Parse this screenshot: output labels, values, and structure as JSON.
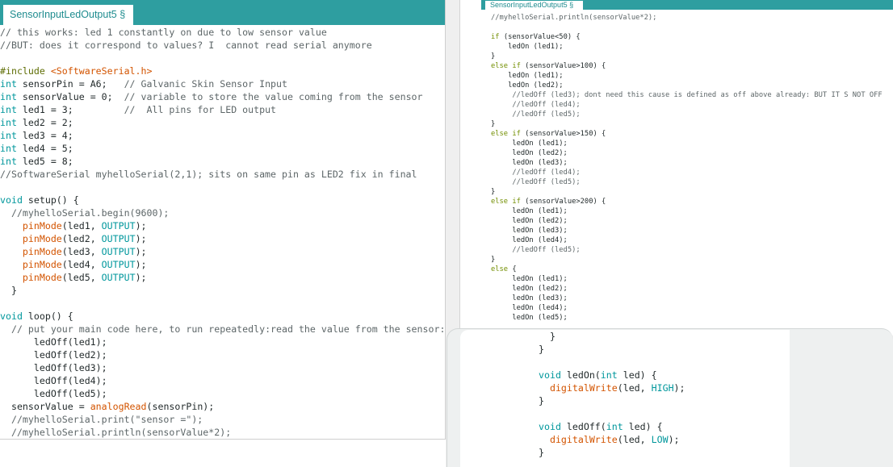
{
  "accent_color": "#2e9ea0",
  "tab_text_color": "#1f8c8f",
  "syntax_colors": {
    "tx": "#232b2c",
    "kw": "#00979c",
    "fn": "#d35400",
    "cm": "#5d6668",
    "pp": "#5e6d03",
    "ctl": "#728e00"
  },
  "left_editor": {
    "tab_label": "SensorInputLedOutput5 §",
    "lines": [
      [
        {
          "cm": "// this works: led 1 constantly on due to low sensor value"
        }
      ],
      [
        {
          "cm": "//BUT: does it correspond to values? I  cannot read serial anymore"
        }
      ],
      [],
      [
        {
          "pp": "#include "
        },
        {
          "fn": "<SoftwareSerial.h>"
        }
      ],
      [
        {
          "kw": "int"
        },
        {
          "tx": " sensorPin = A6;   "
        },
        {
          "cm": "// Galvanic Skin Sensor Input"
        }
      ],
      [
        {
          "kw": "int"
        },
        {
          "tx": " sensorValue = 0;  "
        },
        {
          "cm": "// variable to store the value coming from the sensor"
        }
      ],
      [
        {
          "kw": "int"
        },
        {
          "tx": " led1 = 3;         "
        },
        {
          "cm": "//  All pins for LED output"
        }
      ],
      [
        {
          "kw": "int"
        },
        {
          "tx": " led2 = 2;"
        }
      ],
      [
        {
          "kw": "int"
        },
        {
          "tx": " led3 = 4;"
        }
      ],
      [
        {
          "kw": "int"
        },
        {
          "tx": " led4 = 5;"
        }
      ],
      [
        {
          "kw": "int"
        },
        {
          "tx": " led5 = 8;"
        }
      ],
      [
        {
          "cm": "//SoftwareSerial myhelloSerial(2,1); sits on same pin as LED2 fix in final"
        }
      ],
      [],
      [
        {
          "kw": "void"
        },
        {
          "tx": " setup() {"
        }
      ],
      [
        {
          "tx": "  "
        },
        {
          "cm": "//myhelloSerial.begin(9600);"
        }
      ],
      [
        {
          "tx": "    "
        },
        {
          "fn": "pinMode"
        },
        {
          "tx": "(led1, "
        },
        {
          "kw": "OUTPUT"
        },
        {
          "tx": ");"
        }
      ],
      [
        {
          "tx": "    "
        },
        {
          "fn": "pinMode"
        },
        {
          "tx": "(led2, "
        },
        {
          "kw": "OUTPUT"
        },
        {
          "tx": ");"
        }
      ],
      [
        {
          "tx": "    "
        },
        {
          "fn": "pinMode"
        },
        {
          "tx": "(led3, "
        },
        {
          "kw": "OUTPUT"
        },
        {
          "tx": ");"
        }
      ],
      [
        {
          "tx": "    "
        },
        {
          "fn": "pinMode"
        },
        {
          "tx": "(led4, "
        },
        {
          "kw": "OUTPUT"
        },
        {
          "tx": ");"
        }
      ],
      [
        {
          "tx": "    "
        },
        {
          "fn": "pinMode"
        },
        {
          "tx": "(led5, "
        },
        {
          "kw": "OUTPUT"
        },
        {
          "tx": ");"
        }
      ],
      [
        {
          "tx": "  }"
        }
      ],
      [],
      [
        {
          "kw": "void"
        },
        {
          "tx": " loop() {"
        }
      ],
      [
        {
          "tx": "  "
        },
        {
          "cm": "// put your main code here, to run repeatedly:read the value from the sensor:"
        }
      ],
      [
        {
          "tx": "      ledOff(led1);"
        }
      ],
      [
        {
          "tx": "      ledOff(led2);"
        }
      ],
      [
        {
          "tx": "      ledOff(led3);"
        }
      ],
      [
        {
          "tx": "      ledOff(led4);"
        }
      ],
      [
        {
          "tx": "      ledOff(led5);"
        }
      ],
      [
        {
          "tx": "  sensorValue = "
        },
        {
          "fn": "analogRead"
        },
        {
          "tx": "(sensorPin);"
        }
      ],
      [
        {
          "tx": "  "
        },
        {
          "cm": "//myhelloSerial.print(\"sensor =\");"
        }
      ],
      [
        {
          "tx": "  "
        },
        {
          "cm": "//myhelloSerial.println(sensorValue*2);"
        }
      ]
    ]
  },
  "right_editor": {
    "tab_label": "SensorInputLedOutput5 §",
    "lines": [
      [
        {
          "cm": "//myhelloSerial.println(sensorValue*2);"
        }
      ],
      [],
      [
        {
          "ctl": "if"
        },
        {
          "tx": " (sensorValue<50) {"
        }
      ],
      [
        {
          "tx": "    ledOn (led1);"
        }
      ],
      [
        {
          "tx": "}"
        }
      ],
      [
        {
          "ctl": "else"
        },
        {
          "tx": " "
        },
        {
          "ctl": "if"
        },
        {
          "tx": " (sensorValue>100) {"
        }
      ],
      [
        {
          "tx": "    ledOn (led1);"
        }
      ],
      [
        {
          "tx": "    ledOn (led2);"
        }
      ],
      [
        {
          "tx": "     "
        },
        {
          "cm": "//ledOff (led3); dont need this cause is defined as off above already: BUT IT S NOT OFF"
        }
      ],
      [
        {
          "tx": "     "
        },
        {
          "cm": "//ledOff (led4);"
        }
      ],
      [
        {
          "tx": "     "
        },
        {
          "cm": "//ledOff (led5);"
        }
      ],
      [
        {
          "tx": "}"
        }
      ],
      [
        {
          "ctl": "else"
        },
        {
          "tx": " "
        },
        {
          "ctl": "if"
        },
        {
          "tx": " (sensorValue>150) {"
        }
      ],
      [
        {
          "tx": "     ledOn (led1);"
        }
      ],
      [
        {
          "tx": "     ledOn (led2);"
        }
      ],
      [
        {
          "tx": "     ledOn (led3);"
        }
      ],
      [
        {
          "tx": "     "
        },
        {
          "cm": "//ledOff (led4);"
        }
      ],
      [
        {
          "tx": "     "
        },
        {
          "cm": "//ledOff (led5);"
        }
      ],
      [
        {
          "tx": "}"
        }
      ],
      [
        {
          "ctl": "else"
        },
        {
          "tx": " "
        },
        {
          "ctl": "if"
        },
        {
          "tx": " (sensorValue>200) {"
        }
      ],
      [
        {
          "tx": "     ledOn (led1);"
        }
      ],
      [
        {
          "tx": "     ledOn (led2);"
        }
      ],
      [
        {
          "tx": "     ledOn (led3);"
        }
      ],
      [
        {
          "tx": "     ledOn (led4);"
        }
      ],
      [
        {
          "tx": "     "
        },
        {
          "cm": "//ledOff (led5);"
        }
      ],
      [
        {
          "tx": "}"
        }
      ],
      [
        {
          "ctl": "else"
        },
        {
          "tx": " {"
        }
      ],
      [
        {
          "tx": "     ledOn (led1);"
        }
      ],
      [
        {
          "tx": "     ledOn (led2);"
        }
      ],
      [
        {
          "tx": "     ledOn (led3);"
        }
      ],
      [
        {
          "tx": "     ledOn (led4);"
        }
      ],
      [
        {
          "tx": "     ledOn (led5);"
        }
      ]
    ]
  },
  "bottom_fragment": {
    "lines": [
      [
        {
          "tx": "  }"
        }
      ],
      [
        {
          "tx": "}"
        }
      ],
      [],
      [
        {
          "kw": "void"
        },
        {
          "tx": " ledOn("
        },
        {
          "kw": "int"
        },
        {
          "tx": " led) {"
        }
      ],
      [
        {
          "tx": "  "
        },
        {
          "fn": "digitalWrite"
        },
        {
          "tx": "(led, "
        },
        {
          "kw": "HIGH"
        },
        {
          "tx": ");"
        }
      ],
      [
        {
          "tx": "}"
        }
      ],
      [],
      [
        {
          "kw": "void"
        },
        {
          "tx": " ledOff("
        },
        {
          "kw": "int"
        },
        {
          "tx": " led) {"
        }
      ],
      [
        {
          "tx": "  "
        },
        {
          "fn": "digitalWrite"
        },
        {
          "tx": "(led, "
        },
        {
          "kw": "LOW"
        },
        {
          "tx": ");"
        }
      ],
      [
        {
          "tx": "}"
        }
      ]
    ]
  }
}
